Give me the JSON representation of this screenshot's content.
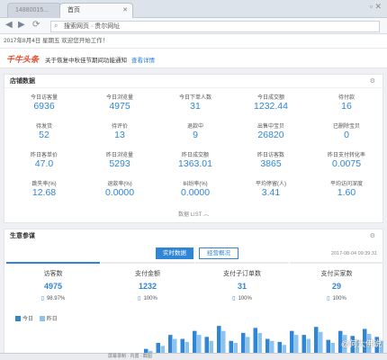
{
  "browser": {
    "tab_inactive": "14880015...",
    "tab_active": "首页",
    "url": "搜索网页 · 贵尔网址"
  },
  "greeting": "2017年8月4日 星期五 欢迎您开始工作！",
  "notice": {
    "logo": "千牛头条",
    "text": "关于恢复中秋佳节期间功能通知",
    "link": "查看详情"
  },
  "store": {
    "title": "店铺数据",
    "collapse": "数据 LIST",
    "metrics": [
      {
        "label": "今日访客量",
        "value": "6936"
      },
      {
        "label": "今日浏览量",
        "value": "4975"
      },
      {
        "label": "今日下单人数",
        "value": "31"
      },
      {
        "label": "今日成交额",
        "value": "1232.44"
      },
      {
        "label": "待付款",
        "value": "16"
      },
      {
        "label": "待发货",
        "value": "52"
      },
      {
        "label": "待评价",
        "value": "13"
      },
      {
        "label": "退款中",
        "value": "9"
      },
      {
        "label": "出售中宝贝",
        "value": "26820"
      },
      {
        "label": "已删除宝贝",
        "value": "0"
      },
      {
        "label": "昨日客单价",
        "value": "47.0"
      },
      {
        "label": "昨日浏览量",
        "value": "5293"
      },
      {
        "label": "昨日成交额",
        "value": "1363.01"
      },
      {
        "label": "昨日访客数",
        "value": "3865"
      },
      {
        "label": "昨日支付转化率",
        "value": "0.0075"
      },
      {
        "label": "跳失率(%)",
        "value": "12.68"
      },
      {
        "label": "退款率(%)",
        "value": "0.0000"
      },
      {
        "label": "纠纷率(%)",
        "value": "0.0000"
      },
      {
        "label": "平均停留(人)",
        "value": "3.41"
      },
      {
        "label": "平均访问深度",
        "value": "1.60"
      }
    ]
  },
  "business": {
    "title": "生意参谋",
    "tab_on": "实时数据",
    "tab_off": "经营概况",
    "time": "2017-08-04 09:39:31",
    "kpis": [
      {
        "label": "访客数",
        "value": "4975",
        "pct": "98.97%"
      },
      {
        "label": "支付金额",
        "value": "1232",
        "pct": "100%"
      },
      {
        "label": "支付子订单数",
        "value": "31",
        "pct": "100%"
      },
      {
        "label": "支付买家数",
        "value": "29",
        "pct": "100%"
      }
    ],
    "legend": [
      "今日",
      "昨日"
    ]
  },
  "chart_data": {
    "type": "bar",
    "series": [
      {
        "name": "今日",
        "values": [
          0,
          0,
          0,
          0,
          0,
          0,
          0,
          0,
          0,
          0,
          12,
          18,
          26,
          22,
          30,
          24,
          35,
          20,
          28,
          33,
          22,
          19,
          30,
          26,
          34,
          21,
          30,
          25,
          32,
          24
        ]
      },
      {
        "name": "昨日",
        "values": [
          0,
          0,
          0,
          0,
          0,
          0,
          0,
          0,
          0,
          0,
          10,
          15,
          22,
          19,
          26,
          20,
          30,
          18,
          24,
          28,
          20,
          16,
          26,
          22,
          29,
          18,
          26,
          21,
          27,
          20
        ]
      }
    ]
  },
  "colors": {
    "accent": "#2f86d6",
    "accent_light": "#8cc3ef"
  },
  "taskbar": "屏幕录制 · 内置 · 截图",
  "watermark": "@何大佛说"
}
